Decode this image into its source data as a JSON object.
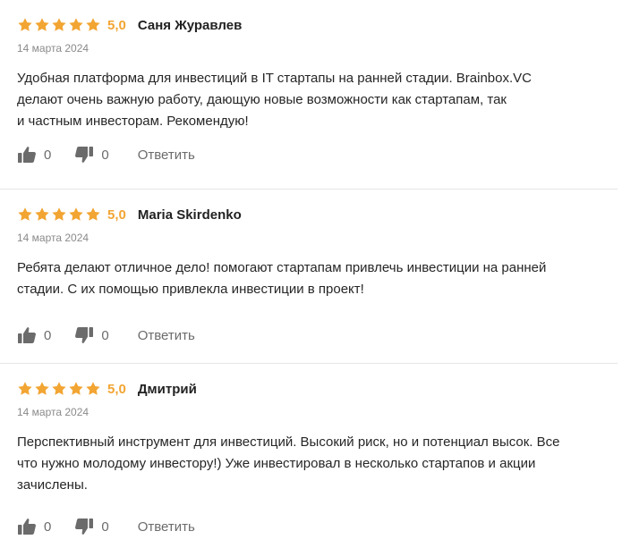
{
  "colors": {
    "star": "#f2a533",
    "text": "#262626",
    "muted": "#8a8a8a",
    "divider": "#e6e6e6",
    "icon": "#6b6b6b"
  },
  "icons": {
    "star": "star-icon",
    "like": "thumbs-up-icon",
    "dislike": "thumbs-down-icon"
  },
  "reviews": [
    {
      "stars": 5,
      "rating": "5,0",
      "author": "Саня Журавлев",
      "date": "14 марта 2024",
      "text_lines": [
        "Удобная платформа для инвестиций в IT стартапы на ранней стадии. Brainbox.VC",
        "делают очень важную работу, дающую новые возможности как стартапам, так",
        "и частным инвесторам. Рекомендую!"
      ],
      "likes": "0",
      "dislikes": "0",
      "reply_label": "Ответить"
    },
    {
      "stars": 5,
      "rating": "5,0",
      "author": "Maria Skirdenko",
      "date": "14 марта 2024",
      "text_lines": [
        "Ребята делают отличное дело! помогают стартапам привлечь инвестиции на ранней",
        "стадии. С их помощью привлекла инвестиции в проект!"
      ],
      "likes": "0",
      "dislikes": "0",
      "reply_label": "Ответить"
    },
    {
      "stars": 5,
      "rating": "5,0",
      "author": "Дмитрий",
      "date": "14 марта 2024",
      "text_lines": [
        "Перспективный инструмент для инвестиций. Высокий риск, но и потенциал высок. Все",
        "что нужно молодому инвестору!) Уже инвестировал в несколько стартапов и акции",
        "зачислены."
      ],
      "likes": "0",
      "dislikes": "0",
      "reply_label": "Ответить"
    }
  ]
}
